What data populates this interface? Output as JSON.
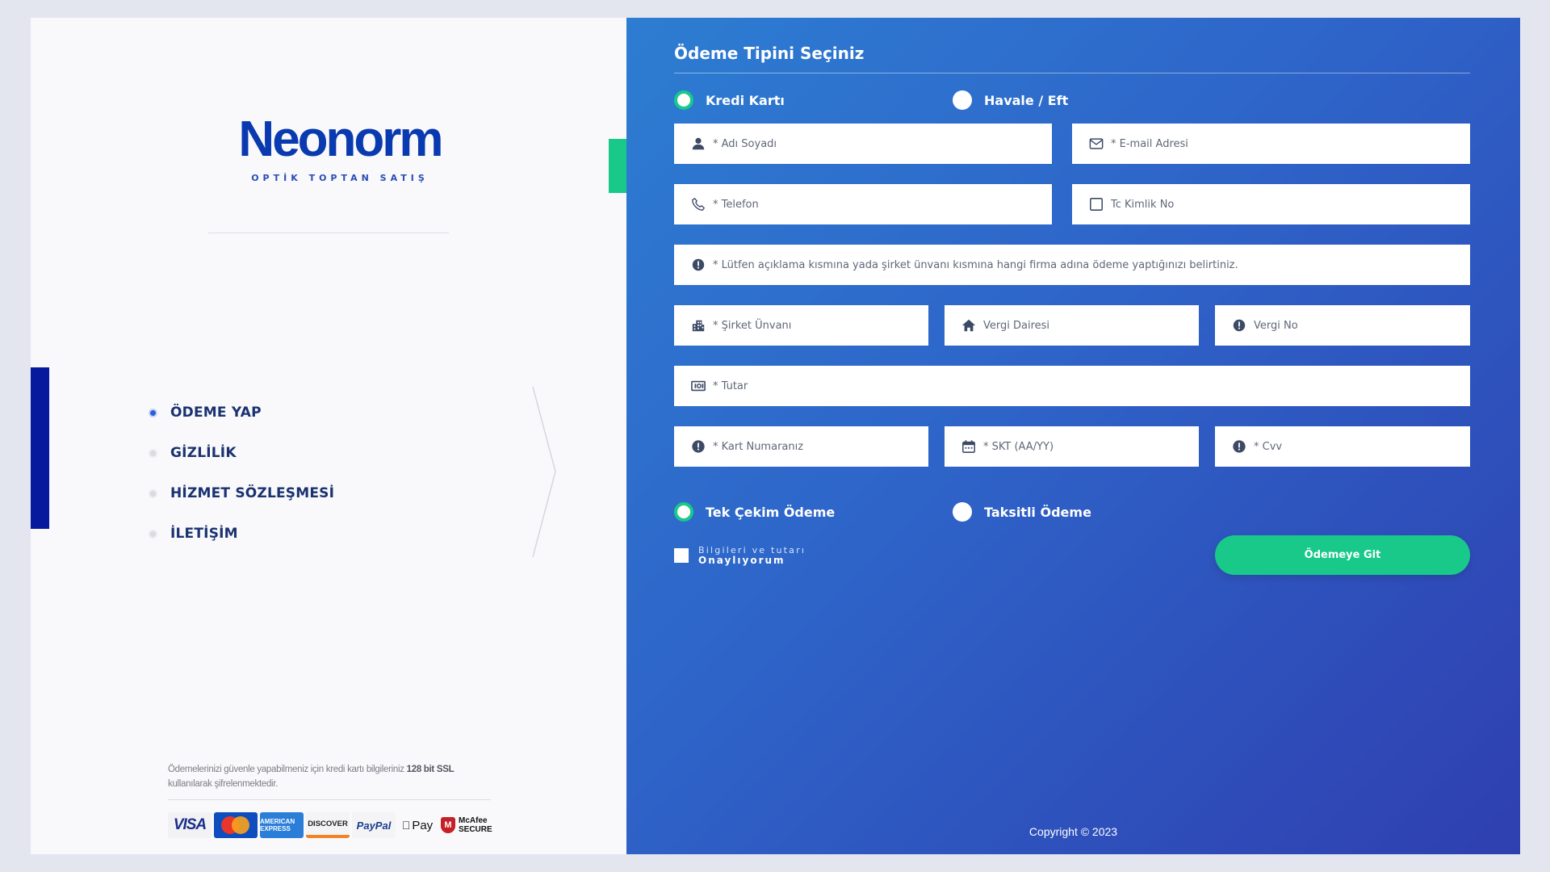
{
  "brand": {
    "name": "Neonorm",
    "tagline": "OPTİK TOPTAN SATIŞ"
  },
  "nav": {
    "items": [
      {
        "label": "ÖDEME YAP",
        "active": true
      },
      {
        "label": "GİZLİLİK",
        "active": false
      },
      {
        "label": "HİZMET SÖZLEŞMESİ",
        "active": false
      },
      {
        "label": "İLETİŞİM",
        "active": false
      }
    ]
  },
  "security": {
    "text_before": "Ödemelerinizi güvenle yapabilmeniz için kredi kartı bilgileriniz",
    "text_bold": "128 bit SSL",
    "text_after": "kullanılarak şifrelenmektedir.",
    "cards": [
      "VISA",
      "MasterCard",
      "AMERICAN EXPRESS",
      "DISCOVER",
      "PayPal",
      "Pay",
      "McAfee SECURE"
    ]
  },
  "form": {
    "title": "Ödeme Tipini Seçiniz",
    "payment_types": [
      {
        "label": "Kredi Kartı",
        "checked": true
      },
      {
        "label": "Havale / Eft",
        "checked": false
      }
    ],
    "fields": {
      "name": "* Adı Soyadı",
      "email": "* E-mail Adresi",
      "phone": "* Telefon",
      "tc_no": "Tc Kimlik No",
      "notice": "* Lütfen açıklama kısmına yada şirket ünvanı kısmına hangi firma adına ödeme yaptığınızı belirtiniz.",
      "company": "* Şirket Ünvanı",
      "tax_office": "Vergi Dairesi",
      "tax_no": "Vergi No",
      "amount": "* Tutar",
      "card_number": "* Kart Numaranız",
      "expiry": "* SKT (AA/YY)",
      "cvv": "* Cvv"
    },
    "installment_types": [
      {
        "label": "Tek Çekim Ödeme",
        "checked": true
      },
      {
        "label": "Taksitli Ödeme",
        "checked": false
      }
    ],
    "consent_line1": "Bilgileri ve tutarı",
    "consent_line2": "Onaylıyorum",
    "submit_label": "Ödemeye Git"
  },
  "footer": {
    "copyright": "Copyright © 2023"
  },
  "colors": {
    "accent_green": "#18c98a",
    "brand_blue": "#0a3ab0",
    "panel_gradient_start": "#2d7dd2",
    "panel_gradient_end": "#2f3fb0"
  }
}
